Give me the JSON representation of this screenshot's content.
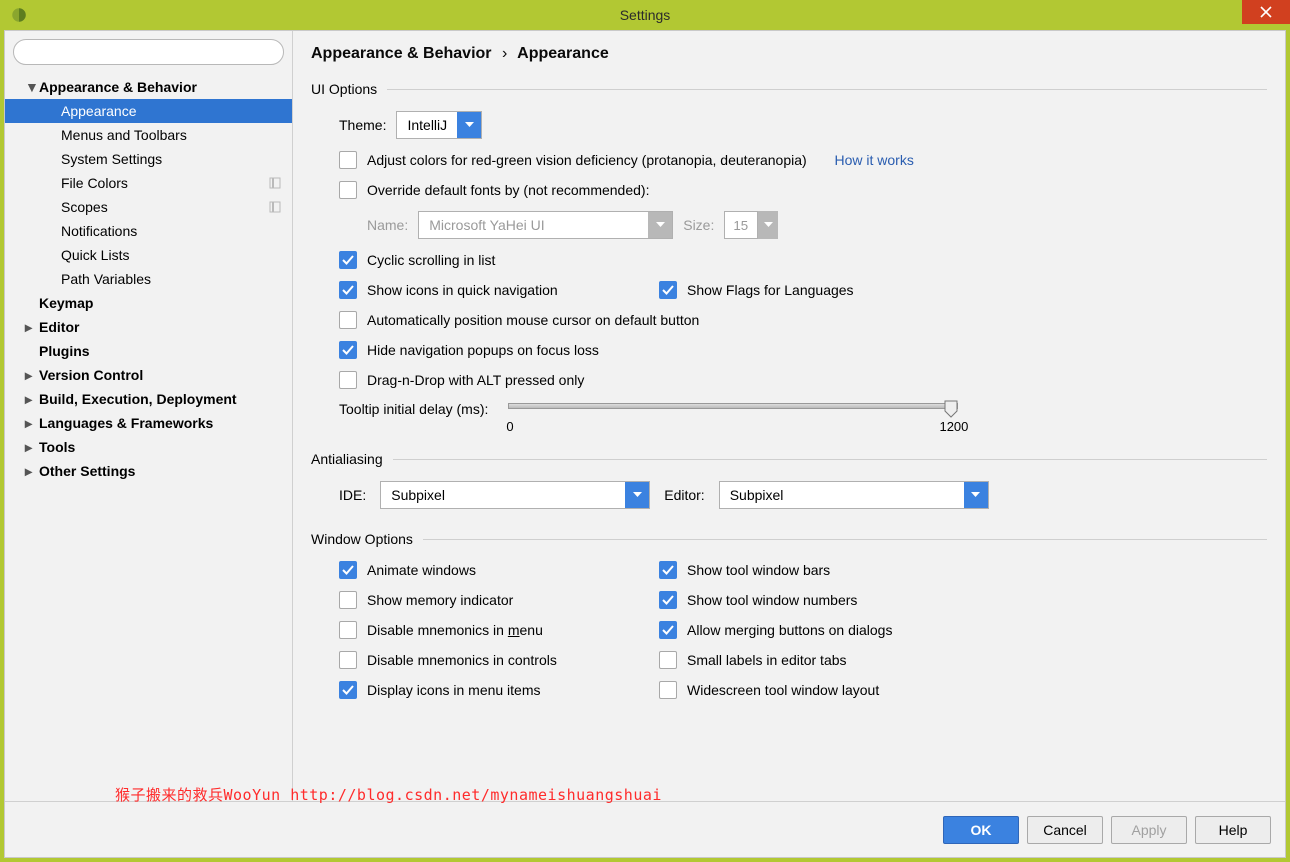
{
  "window": {
    "title": "Settings"
  },
  "breadcrumb": {
    "category": "Appearance & Behavior",
    "page": "Appearance"
  },
  "sidebar": {
    "search_placeholder": "",
    "items": [
      {
        "label": "Appearance & Behavior",
        "bold": true,
        "arrow": "down",
        "level": 1
      },
      {
        "label": "Appearance",
        "level": 2,
        "selected": true
      },
      {
        "label": "Menus and Toolbars",
        "level": 2
      },
      {
        "label": "System Settings",
        "level": 2,
        "arrow": "right"
      },
      {
        "label": "File Colors",
        "level": 2,
        "tag": true
      },
      {
        "label": "Scopes",
        "level": 2,
        "tag": true
      },
      {
        "label": "Notifications",
        "level": 2
      },
      {
        "label": "Quick Lists",
        "level": 2
      },
      {
        "label": "Path Variables",
        "level": 2
      },
      {
        "label": "Keymap",
        "bold": true,
        "level": 1,
        "arrow": "none"
      },
      {
        "label": "Editor",
        "bold": true,
        "level": 1,
        "arrow": "right"
      },
      {
        "label": "Plugins",
        "bold": true,
        "level": 1,
        "arrow": "none"
      },
      {
        "label": "Version Control",
        "bold": true,
        "level": 1,
        "arrow": "right"
      },
      {
        "label": "Build, Execution, Deployment",
        "bold": true,
        "level": 1,
        "arrow": "right"
      },
      {
        "label": "Languages & Frameworks",
        "bold": true,
        "level": 1,
        "arrow": "right"
      },
      {
        "label": "Tools",
        "bold": true,
        "level": 1,
        "arrow": "right"
      },
      {
        "label": "Other Settings",
        "bold": true,
        "level": 1,
        "arrow": "right"
      }
    ]
  },
  "ui_options": {
    "title": "UI Options",
    "theme_label": "Theme:",
    "theme_value": "IntelliJ",
    "cb_adjust_colors": "Adjust colors for red-green vision deficiency (protanopia, deuteranopia)",
    "how_link": "How it works",
    "cb_override_fonts": "Override default fonts by (not recommended):",
    "font_name_label": "Name:",
    "font_name_value": "Microsoft YaHei UI",
    "font_size_label": "Size:",
    "font_size_value": "15",
    "cb_cyclic": "Cyclic scrolling in list",
    "cb_icons_quick": "Show icons in quick navigation",
    "cb_flags": "Show Flags for Languages",
    "cb_auto_mouse": "Automatically position mouse cursor on default button",
    "cb_hide_popup": "Hide navigation popups on focus loss",
    "cb_dnd_alt": "Drag-n-Drop with ALT pressed only",
    "tooltip_label": "Tooltip initial delay (ms):",
    "tooltip_min": "0",
    "tooltip_max": "1200"
  },
  "antialiasing": {
    "title": "Antialiasing",
    "ide_label": "IDE:",
    "ide_value": "Subpixel",
    "editor_label": "Editor:",
    "editor_value": "Subpixel"
  },
  "window_options": {
    "title": "Window Options",
    "cb_animate": "Animate windows",
    "cb_mem": "Show memory indicator",
    "cb_mnemonics_menu_pre": "Disable mnemonics in ",
    "cb_mnemonics_menu_u": "m",
    "cb_mnemonics_menu_post": "enu",
    "cb_mnemonics_ctrl": "Disable mnemonics in controls",
    "cb_icons_menu": "Display icons in menu items",
    "cb_toolbars": "Show tool window bars",
    "cb_toolnumbers": "Show tool window numbers",
    "cb_merge_dialogs": "Allow merging buttons on dialogs",
    "cb_small_labels": "Small labels in editor tabs",
    "cb_widescreen": "Widescreen tool window layout"
  },
  "buttons": {
    "ok": "OK",
    "cancel": "Cancel",
    "apply": "Apply",
    "help": "Help"
  },
  "watermark": "猴子搬来的救兵WooYun http://blog.csdn.net/mynameishuangshuai"
}
